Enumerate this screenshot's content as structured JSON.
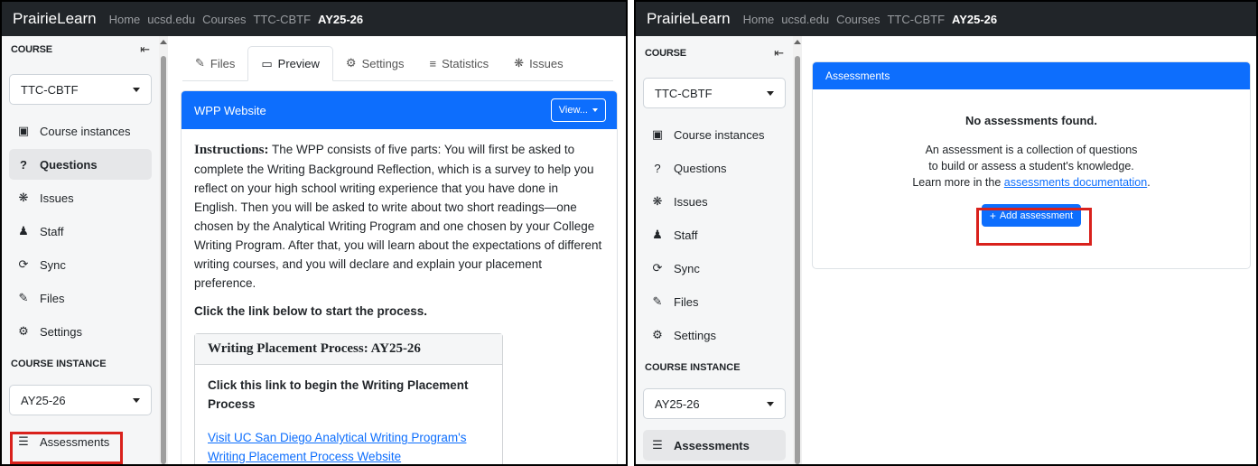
{
  "navbar": {
    "brand": "PrairieLearn",
    "links": [
      "Home",
      "ucsd.edu",
      "Courses",
      "TTC-CBTF"
    ],
    "active": "AY25-26"
  },
  "sidebar": {
    "course_header": "COURSE",
    "collapse_icon": "arrow-left-to-line-icon",
    "course_select": "TTC-CBTF",
    "items": [
      {
        "label": "Course instances",
        "icon": "chalkboard-icon"
      },
      {
        "label": "Questions",
        "icon": "question-icon"
      },
      {
        "label": "Issues",
        "icon": "bug-icon"
      },
      {
        "label": "Staff",
        "icon": "users-icon"
      },
      {
        "label": "Sync",
        "icon": "sync-icon"
      },
      {
        "label": "Files",
        "icon": "edit-icon"
      },
      {
        "label": "Settings",
        "icon": "gear-icon"
      }
    ],
    "instance_header": "COURSE INSTANCE",
    "instance_select": "AY25-26",
    "instance_items": [
      {
        "label": "Assessments",
        "icon": "list-icon"
      }
    ]
  },
  "left": {
    "tabs": [
      "Files",
      "Preview",
      "Settings",
      "Statistics",
      "Issues"
    ],
    "active_tab": "Preview",
    "card_title": "WPP Website",
    "view_button": "View...",
    "instructions_label": "Instructions:",
    "instructions_text": " The WPP consists of five parts: You will first be asked to complete the Writing Background Reflection, which is a survey to help you reflect on your high school writing experience that you have done in English. Then you will be asked to write about two short readings—one chosen by the Analytical Writing Program and one chosen by your College Writing Program. After that, you will learn about the expectations of different writing courses, and you will declare and explain your placement preference.",
    "click_text": "Click the link below to start the process.",
    "inner_title": "Writing Placement Process: AY25-26",
    "inner_bold": "Click this link to begin the Writing Placement Process",
    "inner_link": "Visit UC San Diego Analytical Writing Program's Writing Placement Process Website"
  },
  "right": {
    "card_title": "Assessments",
    "empty_title": "No assessments found.",
    "line1": "An assessment is a collection of questions",
    "line2": "to build or assess a student's knowledge.",
    "line3_pre": "Learn more in the ",
    "line3_link": "assessments documentation",
    "line3_post": ".",
    "add_button": "Add assessment"
  },
  "colors": {
    "navbar": "#212529",
    "primary": "#0d6efd",
    "highlight": "#d9211c",
    "sidebar_bg": "#f5f6f7"
  }
}
